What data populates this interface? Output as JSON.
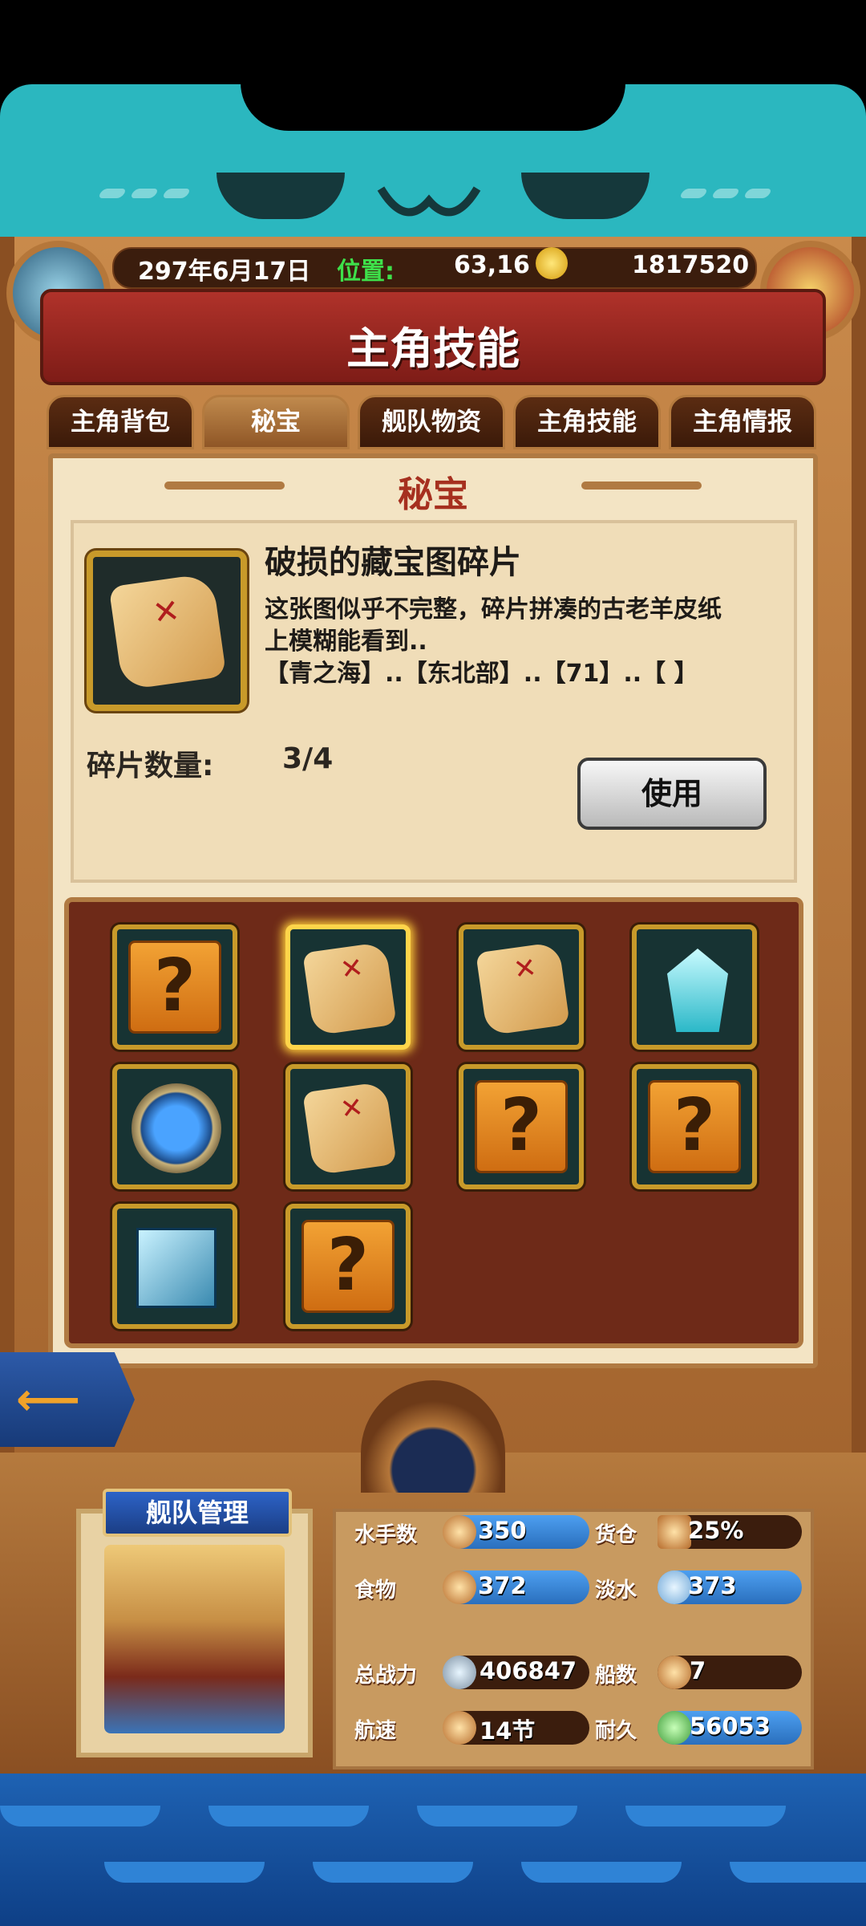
{
  "hud": {
    "date": "297年6月17日",
    "position_label": "位置:",
    "position_value": "63,16",
    "gold": "1817520"
  },
  "title": "主角技能",
  "tabs": [
    "主角背包",
    "秘宝",
    "舰队物资",
    "主角技能",
    "主角情报"
  ],
  "active_tab": "秘宝",
  "section_title": "秘宝",
  "item": {
    "name": "破损的藏宝图碎片",
    "desc_lines": [
      "这张图似乎不完整，碎片拼凑的古老羊皮纸",
      "上模糊能看到..",
      "【青之海】..【东北部】..【71】..【   】"
    ],
    "fragment_label": "碎片数量:",
    "fragment_value": "3/4",
    "use_button": "使用"
  },
  "grid": [
    "unknown",
    "map-fragment-selected",
    "map-fragment",
    "crystal",
    "compass-medallion",
    "map-fragment",
    "unknown",
    "unknown",
    "ice-cube",
    "unknown"
  ],
  "fleet": {
    "banner": "舰队管理",
    "stats": [
      {
        "label": "水手数",
        "value": "350"
      },
      {
        "label": "货仓",
        "value": "25%"
      },
      {
        "label": "食物",
        "value": "372"
      },
      {
        "label": "淡水",
        "value": "373"
      },
      {
        "label": "总战力",
        "value": "406847"
      },
      {
        "label": "船数",
        "value": "7"
      },
      {
        "label": "航速",
        "value": "14节"
      },
      {
        "label": "耐久",
        "value": "56053"
      }
    ]
  },
  "colors": {
    "title_red": "#b0322a",
    "accent_gold": "#c89a2a",
    "panel": "#f3e4c4"
  }
}
